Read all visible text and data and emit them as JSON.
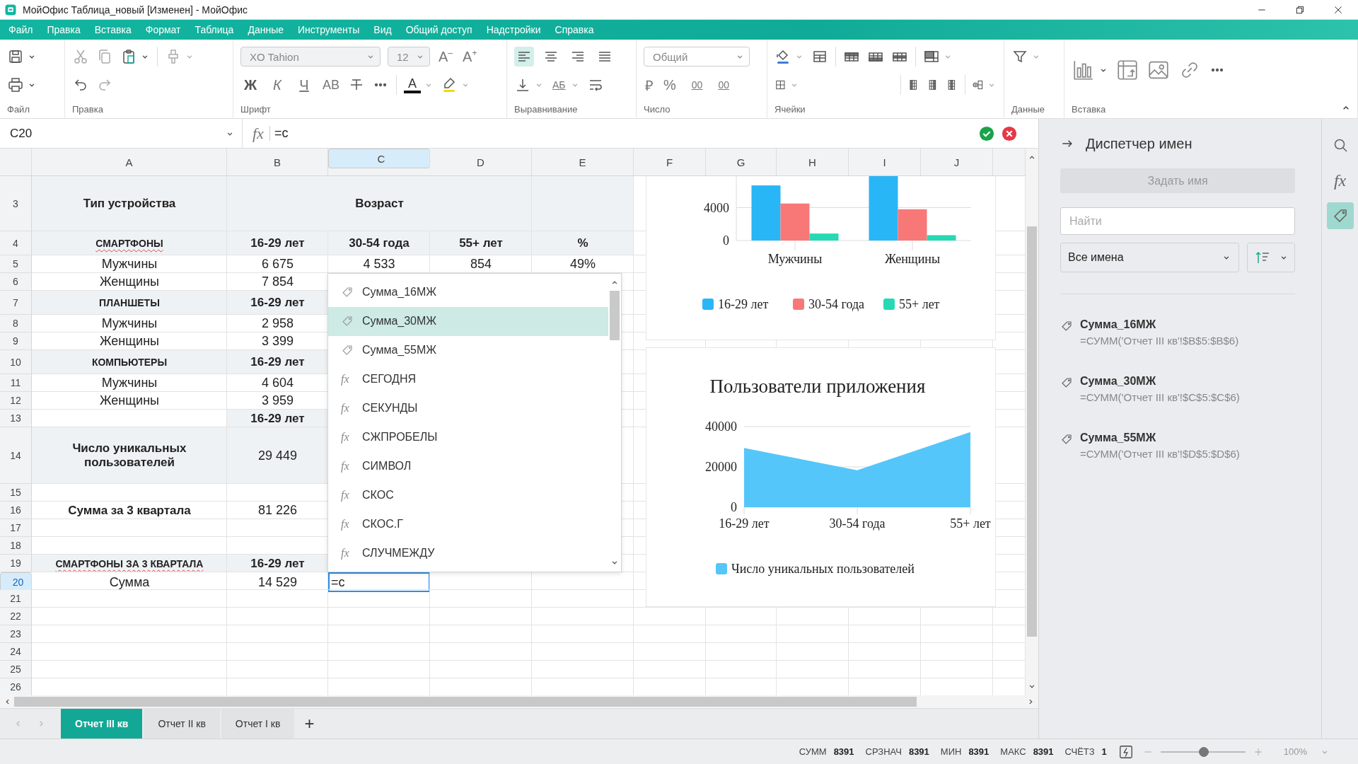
{
  "window": {
    "title": "МойОфис Таблица_новый [Изменен] - МойОфис"
  },
  "menu": [
    "Файл",
    "Правка",
    "Вставка",
    "Формат",
    "Таблица",
    "Данные",
    "Инструменты",
    "Вид",
    "Общий доступ",
    "Надстройки",
    "Справка"
  ],
  "ribbon": {
    "groups": [
      "Файл",
      "Правка",
      "Шрифт",
      "Выравнивание",
      "Число",
      "Ячейки",
      "Данные",
      "Вставка"
    ],
    "font_name": "XO Tahion",
    "font_size": "12",
    "size_buttons": [
      "A$^{–}$",
      "A$^{+}$"
    ],
    "style_buttons": [
      "Ж",
      "К",
      "Ч",
      "АВ"
    ],
    "font_color_button": "A",
    "direction_button": "АБ",
    "number_format": "Общий",
    "number_buttons": [
      "₽",
      "%"
    ],
    "decimal_buttons": [
      "00",
      "00"
    ],
    "align": [
      {
        "kind": "left",
        "selected": true
      },
      {
        "kind": "center",
        "selected": false
      },
      {
        "kind": "right",
        "selected": false
      },
      {
        "kind": "justify",
        "selected": false
      }
    ]
  },
  "formula_bar": {
    "cell": "C20",
    "fx": "fx",
    "formula": "=с"
  },
  "sheet": {
    "columns": [
      {
        "label": "A",
        "selected": false
      },
      {
        "label": "B",
        "selected": false
      },
      {
        "label": "C",
        "selected": true
      },
      {
        "label": "D",
        "selected": false
      },
      {
        "label": "E",
        "selected": false
      },
      {
        "label": "F",
        "selected": false
      },
      {
        "label": "G",
        "selected": false
      },
      {
        "label": "H",
        "selected": false
      },
      {
        "label": "I",
        "selected": false
      },
      {
        "label": "J",
        "selected": false
      }
    ],
    "rows": [
      {
        "number": "3",
        "kind": "title",
        "selected": false,
        "cells": [
          {
            "text": "Тип устройства",
            "kind": "heading",
            "shaded": true
          },
          {
            "text": "Возраст",
            "kind": "heading",
            "shaded": true
          },
          {
            "kind": "merged"
          },
          {
            "kind": "merged"
          },
          {
            "kind": "empty",
            "shaded": true
          }
        ]
      },
      {
        "number": "4",
        "kind": "section",
        "selected": false,
        "cells": [
          {
            "text": "СМАРТФОНЫ",
            "kind": "caption",
            "shaded": true,
            "spell_error": true
          },
          {
            "text": "16-29 лет",
            "kind": "heading",
            "shaded": true
          },
          {
            "text": "30-54 года",
            "kind": "heading",
            "shaded": true
          },
          {
            "text": "55+ лет",
            "kind": "heading",
            "shaded": true
          },
          {
            "text": "%",
            "kind": "heading",
            "shaded": true
          }
        ]
      },
      {
        "number": "5",
        "kind": "plain",
        "selected": false,
        "cells": [
          {
            "text": "Мужчины"
          },
          {
            "text": "6 675"
          },
          {
            "text": "4 533"
          },
          {
            "text": "854"
          },
          {
            "text": "49%"
          }
        ]
      },
      {
        "number": "6",
        "kind": "plain",
        "selected": false,
        "cells": [
          {
            "text": "Женщины"
          },
          {
            "text": "7 854"
          }
        ]
      },
      {
        "number": "7",
        "kind": "section",
        "selected": false,
        "cells": [
          {
            "text": "ПЛАНШЕТЫ",
            "kind": "caption",
            "shaded": true
          },
          {
            "text": "16-29 лет",
            "kind": "heading",
            "shaded": true
          }
        ]
      },
      {
        "number": "8",
        "kind": "plain",
        "selected": false,
        "cells": [
          {
            "text": "Мужчины"
          },
          {
            "text": "2 958"
          }
        ]
      },
      {
        "number": "9",
        "kind": "plain",
        "selected": false,
        "cells": [
          {
            "text": "Женщины"
          },
          {
            "text": "3 399"
          }
        ]
      },
      {
        "number": "10",
        "kind": "section",
        "selected": false,
        "cells": [
          {
            "text": "КОМПЬЮТЕРЫ",
            "kind": "caption",
            "shaded": true
          },
          {
            "text": "16-29 лет",
            "kind": "heading",
            "shaded": true
          }
        ]
      },
      {
        "number": "11",
        "kind": "plain",
        "selected": false,
        "cells": [
          {
            "text": "Мужчины"
          },
          {
            "text": "4 604"
          }
        ]
      },
      {
        "number": "12",
        "kind": "plain",
        "selected": false,
        "cells": [
          {
            "text": "Женщины"
          },
          {
            "text": "3 959"
          }
        ]
      },
      {
        "number": "13",
        "kind": "plain",
        "selected": false,
        "cells": [
          {
            "kind": "empty"
          },
          {
            "text": "16-29 лет",
            "kind": "heading",
            "shaded": true
          }
        ]
      },
      {
        "number": "14",
        "kind": "tall",
        "selected": false,
        "cells": [
          {
            "text": "Число уникальных пользователей",
            "kind": "heading",
            "shaded": true
          },
          {
            "text": "29 449",
            "shaded": true
          }
        ]
      },
      {
        "number": "15",
        "kind": "plain",
        "selected": false
      },
      {
        "number": "16",
        "kind": "plain",
        "selected": false,
        "cells": [
          {
            "text": "Сумма за 3 квартала",
            "kind": "heading"
          },
          {
            "text": "81 226"
          }
        ]
      },
      {
        "number": "17",
        "kind": "plain",
        "selected": false
      },
      {
        "number": "18",
        "kind": "plain",
        "selected": false
      },
      {
        "number": "19",
        "kind": "plain",
        "selected": false,
        "cells": [
          {
            "text": "СМАРТФОНЫ ЗА 3 КВАРТАЛА",
            "kind": "caption",
            "shaded": true,
            "spell_error": true
          },
          {
            "text": "16-29 лет",
            "kind": "heading",
            "shaded": true
          }
        ]
      },
      {
        "number": "20",
        "kind": "plain",
        "selected": true,
        "cells": [
          {
            "text": "Сумма"
          },
          {
            "text": "14 529"
          },
          {
            "text": "=с",
            "editing": true
          }
        ]
      },
      {
        "number": "21",
        "kind": "plain",
        "selected": false
      },
      {
        "number": "22",
        "kind": "plain",
        "selected": false
      },
      {
        "number": "23",
        "kind": "plain",
        "selected": false
      },
      {
        "number": "24",
        "kind": "plain",
        "selected": false
      },
      {
        "number": "25",
        "kind": "plain",
        "selected": false
      },
      {
        "number": "26",
        "kind": "plain",
        "selected": false
      }
    ],
    "autocomplete": [
      {
        "kind": "name",
        "label": "Сумма_16МЖ",
        "selected": false
      },
      {
        "kind": "name",
        "label": "Сумма_30МЖ",
        "selected": true
      },
      {
        "kind": "name",
        "label": "Сумма_55МЖ",
        "selected": false
      },
      {
        "kind": "function",
        "icon": "fx",
        "label": "СЕГОДНЯ",
        "selected": false
      },
      {
        "kind": "function",
        "icon": "fx",
        "label": "СЕКУНДЫ",
        "selected": false
      },
      {
        "kind": "function",
        "icon": "fx",
        "label": "СЖПРОБЕЛЫ",
        "selected": false
      },
      {
        "kind": "function",
        "icon": "fx",
        "label": "СИМВОЛ",
        "selected": false
      },
      {
        "kind": "function",
        "icon": "fx",
        "label": "СКОС",
        "selected": false
      },
      {
        "kind": "function",
        "icon": "fx",
        "label": "СКОС.Г",
        "selected": false
      },
      {
        "kind": "function",
        "icon": "fx",
        "label": "СЛУЧМЕЖДУ",
        "selected": false
      }
    ],
    "charts": [
      {
        "chart_data": {
          "type": "bar",
          "categories": [
            "Мужчины",
            "Женщины"
          ],
          "ylim": [
            0,
            8000
          ],
          "yticks": [
            0,
            4000
          ],
          "legend": "bottom",
          "series": [
            {
              "name": "16-29 лет",
              "color": "#29b6f6",
              "values": [
                6700,
                7900
              ]
            },
            {
              "name": "30-54 года",
              "color": "#f87878",
              "values": [
                4500,
                3800
              ]
            },
            {
              "name": "55+ лет",
              "color": "#26d9b5",
              "values": [
                850,
                650
              ]
            }
          ]
        }
      },
      {
        "chart_data": {
          "type": "area",
          "title": "Пользователи приложения",
          "categories": [
            "16-29 лет",
            "30-54 года",
            "55+ лет"
          ],
          "ylim": [
            0,
            40000
          ],
          "yticks": [
            0,
            20000,
            40000
          ],
          "legend": "bottom",
          "series": [
            {
              "name": "Число уникальных пользователей",
              "color": "#55c6fa",
              "values": [
                29400,
                18300,
                37300
              ]
            }
          ]
        }
      }
    ]
  },
  "sheet_tabs": [
    {
      "label": "Отчет III кв",
      "selected": true
    },
    {
      "label": "Отчет II кв",
      "selected": false
    },
    {
      "label": "Отчет I кв",
      "selected": false
    }
  ],
  "add_sheet": "+",
  "name_manager": {
    "title": "Диспетчер имен",
    "define_button": "Задать имя",
    "define_disabled": true,
    "search_placeholder": "Найти",
    "filter": "Все имена",
    "names": [
      {
        "name": "Сумма_16МЖ",
        "formula": "=СУММ('Отчет III кв'!$B$5:$B$6)"
      },
      {
        "name": "Сумма_30МЖ",
        "formula": "=СУММ('Отчет III кв'!$C$5:$C$6)"
      },
      {
        "name": "Сумма_55МЖ",
        "formula": "=СУММ('Отчет III кв'!$D$5:$D$6)"
      }
    ]
  },
  "side_tools": [
    {
      "kind": "search",
      "selected": false
    },
    {
      "kind": "functions",
      "label": "fx",
      "selected": false
    },
    {
      "kind": "names",
      "selected": true
    }
  ],
  "status_bar": {
    "stats": [
      {
        "label": "СУММ",
        "value": "8391"
      },
      {
        "label": "СРЗНАЧ",
        "value": "8391"
      },
      {
        "label": "МИН",
        "value": "8391"
      },
      {
        "label": "МАКС",
        "value": "8391"
      },
      {
        "label": "СЧЁТЗ",
        "value": "1"
      }
    ],
    "zoom": {
      "level": 0.5,
      "value": "100%"
    }
  }
}
